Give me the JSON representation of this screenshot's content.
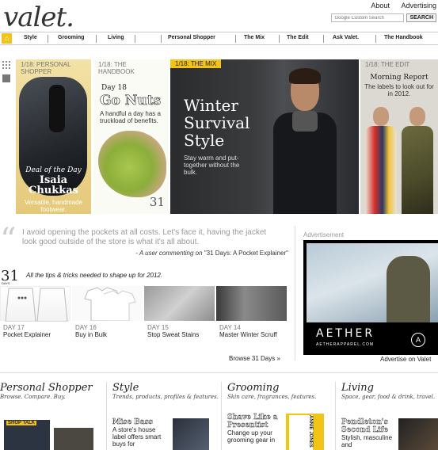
{
  "header": {
    "logo": "valet.",
    "links": [
      "About",
      "Advertising"
    ],
    "search_placeholder": "Google Custom Search",
    "search_button": "SEARCH"
  },
  "nav": {
    "items": [
      "Style",
      "Grooming",
      "Living",
      "Personal Shopper",
      "The Mix",
      "The Edit",
      "Ask Valet.",
      "The Handbook"
    ]
  },
  "hero": {
    "shopper": {
      "tag": "1/18: PERSONAL SHOPPER",
      "kicker": "Deal of the Day",
      "title": "Isaia Chukkas",
      "desc": "Versatile, handmade footwear."
    },
    "handbook": {
      "tag": "1/18: THE HANDBOOK",
      "day": "Day 18",
      "title": "Go Nuts",
      "desc": "A handful a day has a truckload of benefits.",
      "number": "31"
    },
    "mix": {
      "tag": "1/18: THE MIX",
      "title": "Winter Survival Style",
      "desc": "Stay warm and put-together without the bulk."
    },
    "edit": {
      "tag": "1/18: THE EDIT",
      "title": "Morning Report",
      "desc": "The labels to look out for in 2012."
    }
  },
  "quote": {
    "text": "I avoid opening the pockets at all costs. Let's face it, having the jacket look good outside of the store is what it's all about.",
    "cite_prefix": "- A user commenting on",
    "cite_link": "\"31 Days: A Pocket Explainer\""
  },
  "days": {
    "big": "31",
    "small": "DAYS",
    "tagline": "All the tips & tricks needed to shape up for 2012.",
    "tiles": [
      {
        "day": "DAY 17",
        "caption": "Pocket Explainer"
      },
      {
        "day": "DAY 16",
        "caption": "Buy in Bulk"
      },
      {
        "day": "DAY 15",
        "caption": "Stop Sweat Stains"
      },
      {
        "day": "DAY 14",
        "caption": "Master Winter Scruff"
      }
    ],
    "browse": "Browse 31 Days »"
  },
  "ad": {
    "label": "Advertisement",
    "brand": "AETHER",
    "url": "AETHERAPPAREL.COM",
    "caption": "Advertise on Valet"
  },
  "sections": [
    {
      "title": "Personal Shopper",
      "sub": "Browse. Compare. Buy.",
      "badge": "SHOP TALK"
    },
    {
      "title": "Style",
      "sub": "Trends, products, profiles & features.",
      "article_title": "Mise Bass",
      "article_desc": "A store's house label offers smart buys for"
    },
    {
      "title": "Grooming",
      "sub": "Skin care, fragrances, features.",
      "article_title": "Shave Like a Presentist",
      "article_desc": "Change up your grooming gear in",
      "badge": "ANNIE JONES"
    },
    {
      "title": "Living",
      "sub": "Space, gear, food & drink, travel.",
      "article_title": "Pendleton's Second Life",
      "article_desc": "Stylish, masculine and"
    }
  ],
  "colors": {
    "accent": "#f2c418",
    "text": "#222222",
    "muted": "#999999"
  }
}
